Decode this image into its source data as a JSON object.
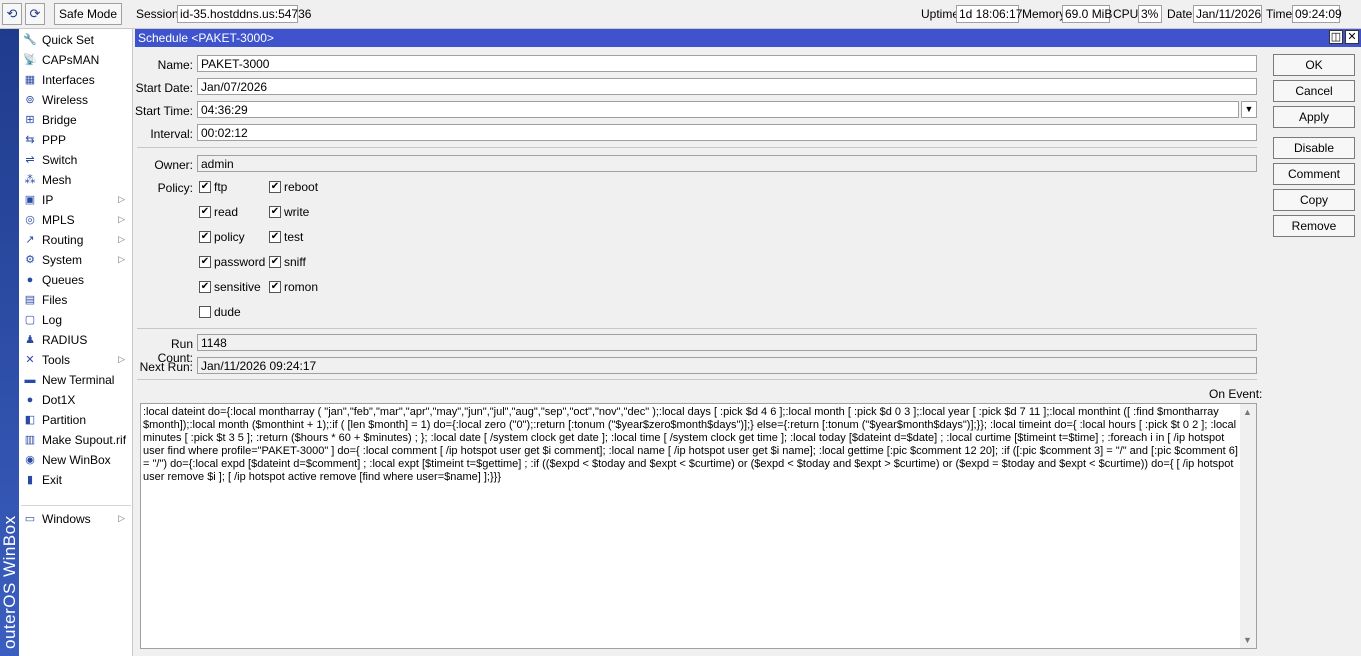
{
  "toolbar": {
    "undo_icon": "undo-icon",
    "redo_icon": "redo-icon",
    "safe_mode_label": "Safe Mode",
    "session_label": "Session:",
    "session_value": "id-35.hostddns.us:54736",
    "uptime_label": "Uptime:",
    "uptime_value": "1d 18:06:17",
    "memory_label": "Memory:",
    "memory_value": "69.0 MiB",
    "cpu_label": "CPU:",
    "cpu_value": "3%",
    "date_label": "Date:",
    "date_value": "Jan/11/2026",
    "time_label": "Time:",
    "time_value": "09:24:09"
  },
  "sidebar": {
    "brand": "outerOS WinBox",
    "items": [
      {
        "label": "Quick Set",
        "icon": "quick-set-icon",
        "glyph": "🔧",
        "submenu": false
      },
      {
        "label": "CAPsMAN",
        "icon": "capsman-icon",
        "glyph": "📡",
        "submenu": false
      },
      {
        "label": "Interfaces",
        "icon": "interfaces-icon",
        "glyph": "▦",
        "submenu": false
      },
      {
        "label": "Wireless",
        "icon": "wireless-icon",
        "glyph": "⊚",
        "submenu": false
      },
      {
        "label": "Bridge",
        "icon": "bridge-icon",
        "glyph": "⊞",
        "submenu": false
      },
      {
        "label": "PPP",
        "icon": "ppp-icon",
        "glyph": "⇆",
        "submenu": false
      },
      {
        "label": "Switch",
        "icon": "switch-icon",
        "glyph": "⇌",
        "submenu": false
      },
      {
        "label": "Mesh",
        "icon": "mesh-icon",
        "glyph": "⁂",
        "submenu": false
      },
      {
        "label": "IP",
        "icon": "ip-icon",
        "glyph": "▣",
        "submenu": true
      },
      {
        "label": "MPLS",
        "icon": "mpls-icon",
        "glyph": "◎",
        "submenu": true
      },
      {
        "label": "Routing",
        "icon": "routing-icon",
        "glyph": "↗",
        "submenu": true
      },
      {
        "label": "System",
        "icon": "system-icon",
        "glyph": "⚙",
        "submenu": true
      },
      {
        "label": "Queues",
        "icon": "queues-icon",
        "glyph": "●",
        "submenu": false
      },
      {
        "label": "Files",
        "icon": "files-icon",
        "glyph": "▤",
        "submenu": false
      },
      {
        "label": "Log",
        "icon": "log-icon",
        "glyph": "▢",
        "submenu": false
      },
      {
        "label": "RADIUS",
        "icon": "radius-icon",
        "glyph": "♟",
        "submenu": false
      },
      {
        "label": "Tools",
        "icon": "tools-icon",
        "glyph": "✕",
        "submenu": true
      },
      {
        "label": "New Terminal",
        "icon": "terminal-icon",
        "glyph": "▬",
        "submenu": false
      },
      {
        "label": "Dot1X",
        "icon": "dot1x-icon",
        "glyph": "●",
        "submenu": false
      },
      {
        "label": "Partition",
        "icon": "partition-icon",
        "glyph": "◧",
        "submenu": false
      },
      {
        "label": "Make Supout.rif",
        "icon": "supout-icon",
        "glyph": "▥",
        "submenu": false
      },
      {
        "label": "New WinBox",
        "icon": "winbox-icon",
        "glyph": "◉",
        "submenu": false
      },
      {
        "label": "Exit",
        "icon": "exit-icon",
        "glyph": "▮",
        "submenu": false
      },
      {
        "label": "Windows",
        "icon": "windows-icon",
        "glyph": "▭",
        "submenu": true
      }
    ]
  },
  "window": {
    "title": "Schedule <PAKET-3000>",
    "name_label": "Name:",
    "name_value": "PAKET-3000",
    "start_date_label": "Start Date:",
    "start_date_value": "Jan/07/2026",
    "start_time_label": "Start Time:",
    "start_time_value": "04:36:29",
    "interval_label": "Interval:",
    "interval_value": "00:02:12",
    "owner_label": "Owner:",
    "owner_value": "admin",
    "policy_label": "Policy:",
    "policies": [
      {
        "label": "ftp",
        "checked": true
      },
      {
        "label": "reboot",
        "checked": true
      },
      {
        "label": "read",
        "checked": true
      },
      {
        "label": "write",
        "checked": true
      },
      {
        "label": "policy",
        "checked": true
      },
      {
        "label": "test",
        "checked": true
      },
      {
        "label": "password",
        "checked": true
      },
      {
        "label": "sniff",
        "checked": true
      },
      {
        "label": "sensitive",
        "checked": true
      },
      {
        "label": "romon",
        "checked": true
      },
      {
        "label": "dude",
        "checked": false
      }
    ],
    "run_count_label": "Run Count:",
    "run_count_value": "1148",
    "next_run_label": "Next Run:",
    "next_run_value": "Jan/11/2026 09:24:17",
    "on_event_label": "On Event:",
    "on_event_value": ":local dateint do={:local montharray ( \"jan\",\"feb\",\"mar\",\"apr\",\"may\",\"jun\",\"jul\",\"aug\",\"sep\",\"oct\",\"nov\",\"dec\" );:local days [ :pick $d 4 6 ];:local month [ :pick $d 0 3 ];:local year [ :pick $d 7 11 ];:local monthint ([ :find $montharray $month]);:local month ($monthint + 1);:if ( [len $month] = 1) do={:local zero (\"0\");:return [:tonum (\"$year$zero$month$days\")];} else={:return [:tonum (\"$year$month$days\")];}}; :local timeint do={ :local hours [ :pick $t 0 2 ]; :local minutes [ :pick $t 3 5 ]; :return ($hours * 60 + $minutes) ; }; :local date [ /system clock get date ]; :local time [ /system clock get time ]; :local today [$dateint d=$date] ; :local curtime [$timeint t=$time] ; :foreach i in [ /ip hotspot user find where profile=\"PAKET-3000\" ] do={ :local comment [ /ip hotspot user get $i comment]; :local name [ /ip hotspot user get $i name]; :local gettime [:pic $comment 12 20]; :if ([:pic $comment 3] = \"/\" and [:pic $comment 6] = \"/\") do={:local expd [$dateint d=$comment] ; :local expt [$timeint t=$gettime] ; :if (($expd < $today and $expt < $curtime) or ($expd < $today and $expt > $curtime) or ($expd = $today and $expt < $curtime)) do={ [ /ip hotspot user remove $i ]; [ /ip hotspot active remove [find where user=$name] ];}}}"
  },
  "buttons": {
    "ok": "OK",
    "cancel": "Cancel",
    "apply": "Apply",
    "disable": "Disable",
    "comment": "Comment",
    "copy": "Copy",
    "remove": "Remove"
  },
  "colors": {
    "titlebar": "#3f54cc",
    "sidebar_brand": "#2a4aa8"
  }
}
